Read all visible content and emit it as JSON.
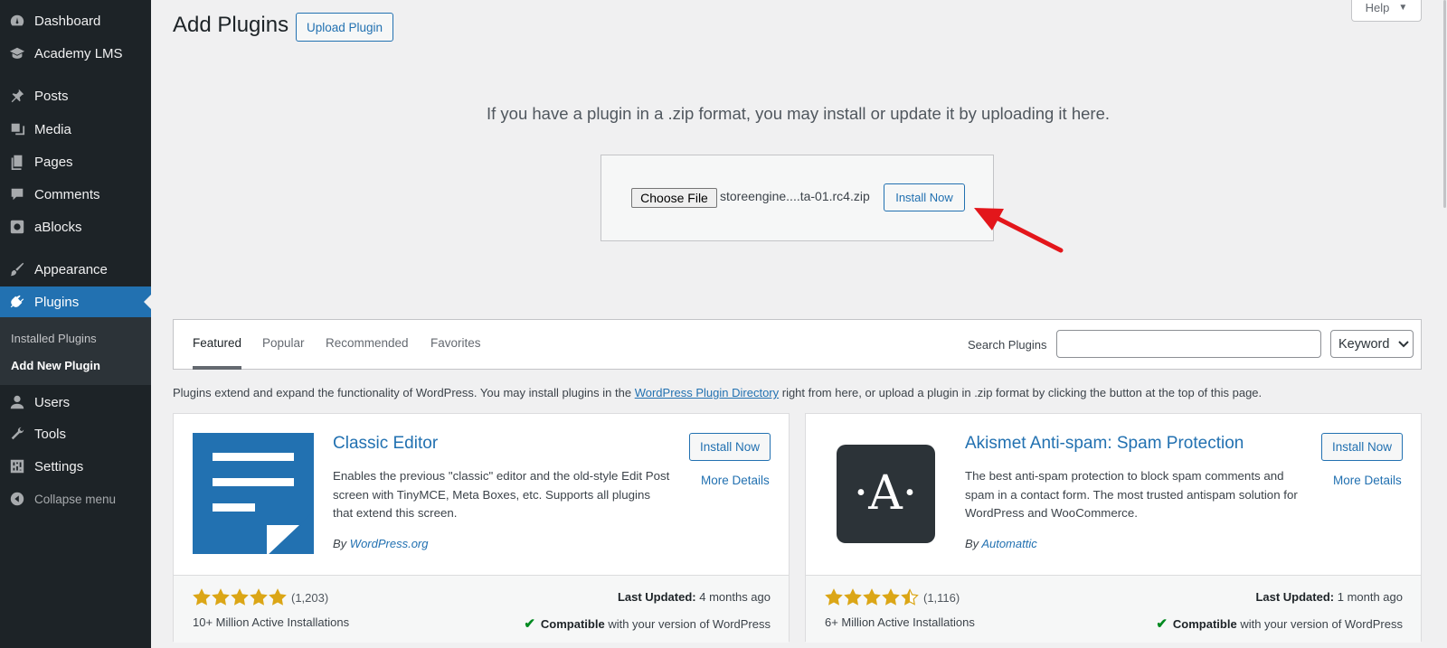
{
  "sidebar": {
    "items": [
      {
        "label": "Dashboard",
        "icon": "dashboard-icon"
      },
      {
        "label": "Academy LMS",
        "icon": "academy-icon"
      },
      {
        "label": "Posts",
        "icon": "pin-icon"
      },
      {
        "label": "Media",
        "icon": "media-icon"
      },
      {
        "label": "Pages",
        "icon": "pages-icon"
      },
      {
        "label": "Comments",
        "icon": "comment-icon"
      },
      {
        "label": "aBlocks",
        "icon": "ablocks-icon"
      },
      {
        "label": "Appearance",
        "icon": "brush-icon"
      },
      {
        "label": "Plugins",
        "icon": "plugin-icon"
      },
      {
        "label": "Users",
        "icon": "user-icon"
      },
      {
        "label": "Tools",
        "icon": "wrench-icon"
      },
      {
        "label": "Settings",
        "icon": "settings-icon"
      },
      {
        "label": "Collapse menu",
        "icon": "collapse-icon"
      }
    ],
    "submenu": [
      "Installed Plugins",
      "Add New Plugin"
    ]
  },
  "header": {
    "title": "Add Plugins",
    "upload_label": "Upload Plugin",
    "help_label": "Help"
  },
  "upload": {
    "text": "If you have a plugin in a .zip format, you may install or update it by uploading it here.",
    "choose_label": "Choose File",
    "file_name": "storeengine....ta-01.rc4.zip",
    "install_label": "Install Now"
  },
  "filter": {
    "tabs": [
      "Featured",
      "Popular",
      "Recommended",
      "Favorites"
    ],
    "search_label": "Search Plugins",
    "search_value": "",
    "select_value": "Keyword"
  },
  "intro": {
    "before": "Plugins extend and expand the functionality of WordPress. You may install plugins in the ",
    "link": "WordPress Plugin Directory",
    "after": " right from here, or upload a plugin in .zip format by clicking the button at the top of this page."
  },
  "plugins": [
    {
      "name": "Classic Editor",
      "description": "Enables the previous \"classic\" editor and the old-style Edit Post screen with TinyMCE, Meta Boxes, etc. Supports all plugins that extend this screen.",
      "by": "By ",
      "author": "WordPress.org",
      "install_label": "Install Now",
      "details_label": "More Details",
      "rating": 5,
      "rating_count": "(1,203)",
      "installs": "10+ Million Active Installations",
      "last_updated_label": "Last Updated:",
      "last_updated": " 4 months ago",
      "compatible_label": "Compatible",
      "compatible_text": " with your version of WordPress"
    },
    {
      "name": "Akismet Anti-spam: Spam Protection",
      "description": "The best anti-spam protection to block spam comments and spam in a contact form. The most trusted antispam solution for WordPress and WooCommerce.",
      "by": "By ",
      "author": "Automattic",
      "icon_text": "·A·",
      "install_label": "Install Now",
      "details_label": "More Details",
      "rating": 4.5,
      "rating_count": "(1,116)",
      "installs": "6+ Million Active Installations",
      "last_updated_label": "Last Updated:",
      "last_updated": " 1 month ago",
      "compatible_label": "Compatible",
      "compatible_text": " with your version of WordPress"
    }
  ],
  "colors": {
    "sidebar_bg": "#1d2327",
    "accent": "#2271b1",
    "star": "#dba617",
    "arrow": "#e3161b",
    "check": "#008a20"
  }
}
